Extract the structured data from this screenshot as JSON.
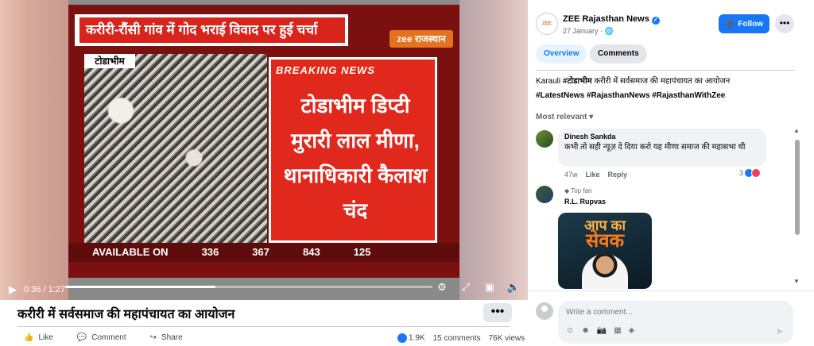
{
  "video": {
    "headline": "करीरी-रौंसी गांव में गोद भराई विवाद पर हुई चर्चा",
    "channel_logo": "zee राजस्थान",
    "location_tag": "टोडाभीम",
    "breaking_label": "BREAKING NEWS",
    "breaking_text": "टोडाभीम डिप्टी मुरारी लाल मीणा, थानाधिकारी कैलाश चंद",
    "ticker": [
      "AVAILABLE ON",
      "336",
      "367",
      "843",
      "125"
    ],
    "current_time": "0:36",
    "duration": "1:27",
    "progress_fraction": 0.41,
    "icons": {
      "play": "play-icon",
      "settings": "gear-icon",
      "fullscreen": "expand-icon",
      "pip": "picture-in-picture-icon",
      "volume": "volume-icon"
    }
  },
  "below": {
    "title": "करीरी में सर्वसमाज की महापंचायत का आयोजन",
    "more": "•••",
    "like": "Like",
    "comment": "Comment",
    "share": "Share",
    "reactions_count": "1.9K",
    "comments_count": "15 comments",
    "views_count": "76K views"
  },
  "panel": {
    "page_name": "ZEE Rajasthan News",
    "page_logo": "ZEE",
    "date": "27 January",
    "privacy_icon": "globe-icon",
    "follow_label": "Follow",
    "more": "•••",
    "tabs": {
      "overview": "Overview",
      "comments": "Comments"
    },
    "caption_lead": "Karauli",
    "caption_tag1": "#टोडाभीम",
    "caption_rest": "करीरी में सर्वसमाज की महापंचायत का आयोजन",
    "hashtags": "#LatestNews #RajasthanNews #RajasthanWithZee",
    "sort_label": "Most relevant",
    "comments": [
      {
        "author": "Dinesh Sankda",
        "text": "कभी तो सही न्यूज़ दे दिया करो यह मीणा समाज की महासभा थी",
        "age": "47w",
        "like": "Like",
        "reply": "Reply",
        "reactions": "3"
      },
      {
        "badge": "Top fan",
        "author": "R.L. Rupvas",
        "sticker_top": "आप का",
        "sticker_big": "सेवक"
      }
    ],
    "write_placeholder": "Write a comment...",
    "accent": "#1877f2"
  }
}
